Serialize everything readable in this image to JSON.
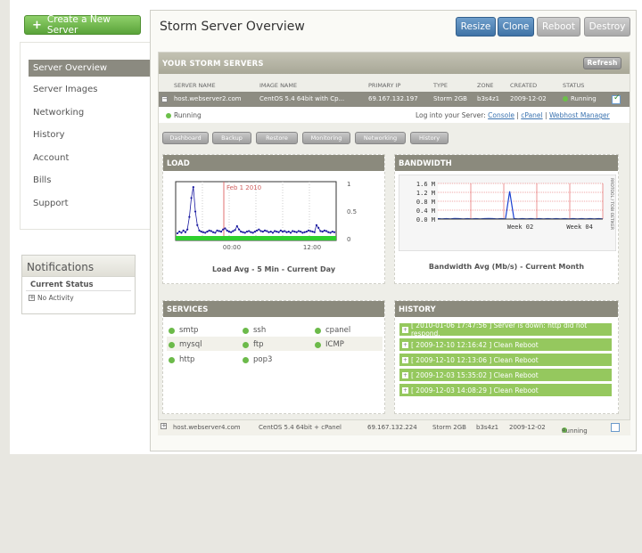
{
  "sidebar": {
    "create_label": "Create a New Server",
    "items": [
      {
        "label": "Server Overview"
      },
      {
        "label": "Server Images"
      },
      {
        "label": "Networking"
      },
      {
        "label": "History"
      },
      {
        "label": "Account"
      },
      {
        "label": "Bills"
      },
      {
        "label": "Support"
      }
    ]
  },
  "notifications": {
    "title": "Notifications",
    "subtitle": "Current Status",
    "item": "No Activity"
  },
  "main": {
    "title": "Storm Server Overview",
    "buttons": [
      {
        "label": "Resize",
        "style": "blue"
      },
      {
        "label": "Clone",
        "style": "blue"
      },
      {
        "label": "Reboot",
        "style": "grey"
      },
      {
        "label": "Destroy",
        "style": "grey"
      }
    ],
    "servers_title": "YOUR STORM SERVERS",
    "refresh_label": "Refresh",
    "columns": [
      "SERVER NAME",
      "IMAGE NAME",
      "PRIMARY IP",
      "TYPE",
      "ZONE",
      "CREATED",
      "STATUS"
    ],
    "selected_server": {
      "name": "host.webserver2.com",
      "image": "CentOS 5.4 64bit with Cp...",
      "ip": "69.167.132.197",
      "type": "Storm 2GB",
      "zone": "b3s4z1",
      "created": "2009-12-02",
      "status": "Running",
      "checked": true
    },
    "status_line": {
      "status": "Running",
      "login_text": "Log into your Server:",
      "links": [
        "Console",
        "cPanel",
        "Webhost Manager"
      ],
      "sep": "|"
    },
    "tabs": [
      "Dashboard",
      "Backup",
      "Restore",
      "Monitoring",
      "Networking",
      "History"
    ],
    "other_server": {
      "name": "host.webserver4.com",
      "image": "CentOS 5.4 64bit + cPanel",
      "ip": "69.167.132.224",
      "type": "Storm 2GB",
      "zone": "b3s4z1",
      "created": "2009-12-02",
      "status": "Running",
      "checked": false
    }
  },
  "load_panel": {
    "title": "LOAD",
    "caption": "Load Avg - 5 Min - Current Day"
  },
  "bandwidth_panel": {
    "title": "BANDWIDTH",
    "caption": "Bandwidth Avg (Mb/s) - Current Month",
    "side_label": "RRDTOOL / TOBI OETIKER"
  },
  "services_panel": {
    "title": "SERVICES",
    "items": [
      "smtp",
      "ssh",
      "cpanel",
      "mysql",
      "ftp",
      "ICMP",
      "http",
      "pop3"
    ]
  },
  "history_panel": {
    "title": "HISTORY",
    "items": [
      "[ 2010-01-06 17:47:56 ] Server is down: http did not respond.",
      "[ 2009-12-10 12:16:42 ] Clean Reboot",
      "[ 2009-12-10 12:13:06 ] Clean Reboot",
      "[ 2009-12-03 15:35:02 ] Clean Reboot",
      "[ 2009-12-03 14:08:29 ] Clean Reboot"
    ]
  },
  "chart_data": [
    {
      "type": "line",
      "title": "Load Avg - 5 Min - Current Day",
      "xlabel": "",
      "ylabel": "",
      "x_ticks": [
        "00:00",
        "12:00"
      ],
      "y_ticks": [
        "0",
        "0.5",
        "1"
      ],
      "ylim": [
        0,
        1
      ],
      "annotation": "Feb 1 2010",
      "series": [
        {
          "values": [
            0.05,
            0.08,
            0.06,
            0.1,
            0.07,
            0.12,
            0.35,
            0.7,
            0.9,
            0.45,
            0.2,
            0.1,
            0.08,
            0.07,
            0.06,
            0.08,
            0.1,
            0.09,
            0.07,
            0.06,
            0.1,
            0.09,
            0.08,
            0.12,
            0.14,
            0.1,
            0.08,
            0.07,
            0.09,
            0.11,
            0.18,
            0.12,
            0.08,
            0.07,
            0.06,
            0.08,
            0.09,
            0.07,
            0.06,
            0.08,
            0.1,
            0.12,
            0.09,
            0.08,
            0.1,
            0.09,
            0.07,
            0.08,
            0.06,
            0.09,
            0.08,
            0.07,
            0.1,
            0.08,
            0.09,
            0.07,
            0.08,
            0.06,
            0.09,
            0.08,
            0.07,
            0.09,
            0.08,
            0.06,
            0.07,
            0.08,
            0.1,
            0.09,
            0.08,
            0.07,
            0.2,
            0.15,
            0.09,
            0.08,
            0.1,
            0.09,
            0.07,
            0.06,
            0.08,
            0.07
          ]
        }
      ]
    },
    {
      "type": "line",
      "title": "Bandwidth Avg (Mb/s) - Current Month",
      "xlabel": "",
      "ylabel": "",
      "x_ticks": [
        "Week 02",
        "Week 04"
      ],
      "y_ticks": [
        "0.0 M",
        "0.4 M",
        "0.8 M",
        "1.2 M",
        "1.6 M"
      ],
      "ylim": [
        0,
        1.6
      ],
      "series": [
        {
          "values": [
            0.02,
            0.01,
            0.02,
            0.01,
            0.03,
            0.02,
            0.01,
            0.02,
            0.01,
            0.02,
            0.01,
            0.02,
            0.03,
            0.02,
            0.01,
            0.02,
            0.01,
            1.25,
            0.02,
            0.01,
            0.02,
            0.01,
            0.02,
            0.01,
            0.02,
            0.01,
            0.02,
            0.01,
            0.02,
            0.01,
            0.02,
            0.01,
            0.02,
            0.01,
            0.02,
            0.01,
            0.02,
            0.01,
            0.02,
            0.01
          ]
        }
      ]
    }
  ]
}
